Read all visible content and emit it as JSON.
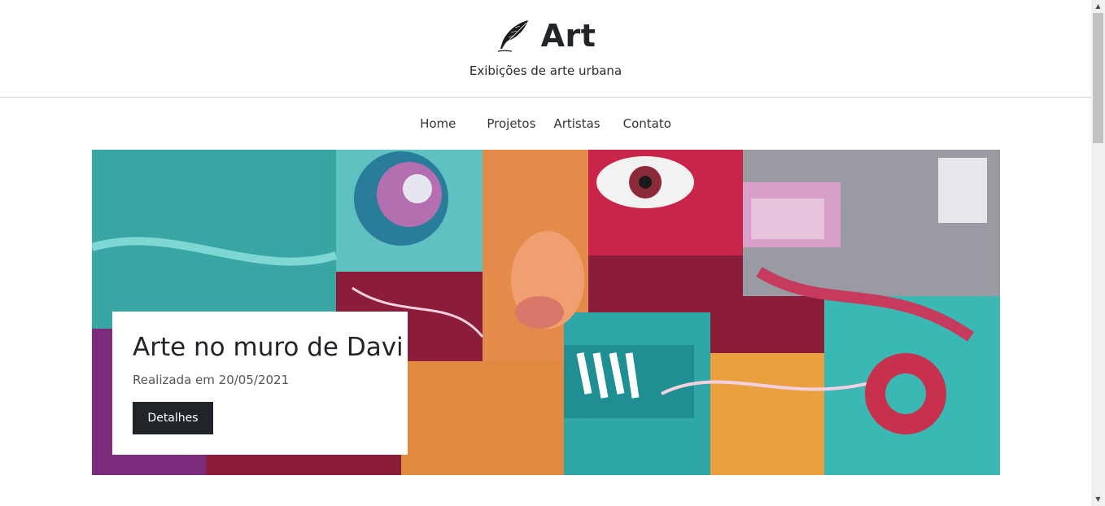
{
  "brand": {
    "title": "Art",
    "icon": "feather-quill-icon"
  },
  "subtitle": "Exibições de arte urbana",
  "nav": {
    "home": "Home",
    "projetos": "Projetos",
    "artistas": "Artistas",
    "contato": "Contato"
  },
  "hero": {
    "image": "street-art-graffiti-image",
    "card": {
      "title": "Arte no muro de Davi",
      "date": "Realizada em 20/05/2021",
      "button": "Detalhes"
    }
  },
  "colors": {
    "dark": "#212529",
    "teal": "#3bb8b4",
    "crimson": "#9b1b30",
    "orange": "#e8913f",
    "pink": "#d95a8a"
  },
  "scrollbar": {
    "up_icon": "scroll-up-arrow-icon",
    "down_icon": "scroll-down-arrow-icon"
  }
}
